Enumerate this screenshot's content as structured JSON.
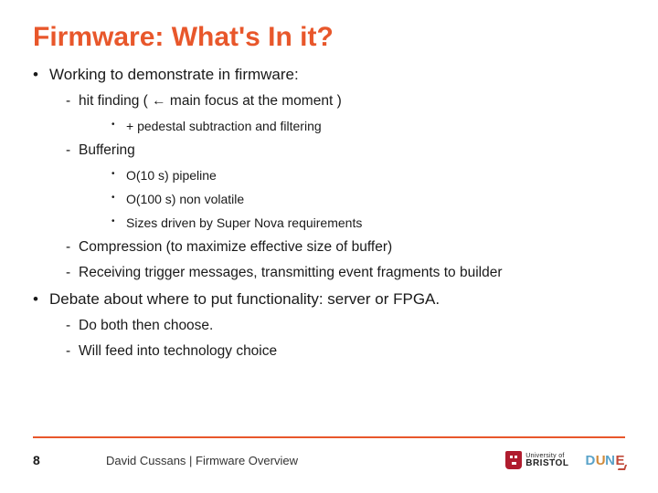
{
  "title": "Firmware: What's In it?",
  "bullets": {
    "b1": "Working to demonstrate in firmware:",
    "b1_s1": "hit finding ( ← main focus at the moment )",
    "b1_s1_t1": "+ pedestal subtraction and filtering",
    "b1_s2": "Buffering",
    "b1_s2_t1": "O(10 s) pipeline",
    "b1_s2_t2": "O(100 s) non volatile",
    "b1_s2_t3": "Sizes driven by Super Nova requirements",
    "b1_s3": "Compression (to maximize effective size of buffer)",
    "b1_s4": "Receiving trigger messages, transmitting event fragments to builder",
    "b2": "Debate about where to put functionality: server or FPGA.",
    "b2_s1": "Do both then choose.",
    "b2_s2": "Will feed into technology choice"
  },
  "footer": {
    "page": "8",
    "text": "David Cussans | Firmware Overview",
    "bristol_l1": "University of",
    "bristol_l2": "BRISTOL",
    "dune_d": "D",
    "dune_u": "U",
    "dune_n": "N",
    "dune_e": "E"
  }
}
